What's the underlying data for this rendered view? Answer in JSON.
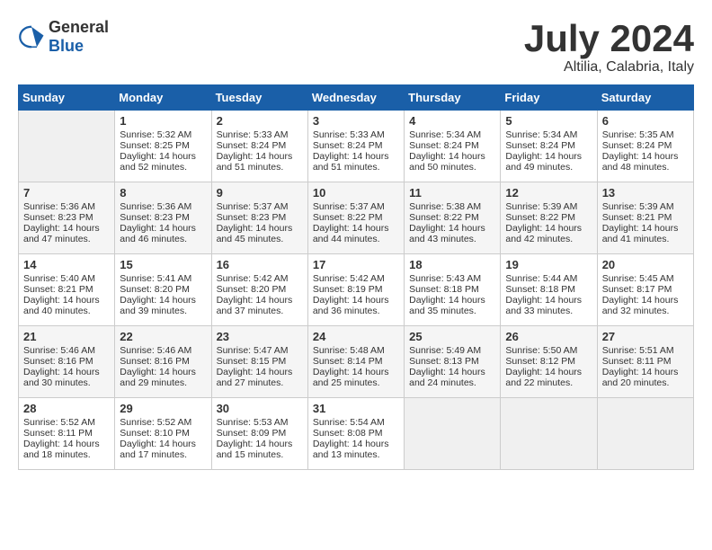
{
  "header": {
    "logo_general": "General",
    "logo_blue": "Blue",
    "month_title": "July 2024",
    "subtitle": "Altilia, Calabria, Italy"
  },
  "weekdays": [
    "Sunday",
    "Monday",
    "Tuesday",
    "Wednesday",
    "Thursday",
    "Friday",
    "Saturday"
  ],
  "weeks": [
    [
      {
        "day": "",
        "sunrise": "",
        "sunset": "",
        "daylight": ""
      },
      {
        "day": "1",
        "sunrise": "Sunrise: 5:32 AM",
        "sunset": "Sunset: 8:25 PM",
        "daylight": "Daylight: 14 hours and 52 minutes."
      },
      {
        "day": "2",
        "sunrise": "Sunrise: 5:33 AM",
        "sunset": "Sunset: 8:24 PM",
        "daylight": "Daylight: 14 hours and 51 minutes."
      },
      {
        "day": "3",
        "sunrise": "Sunrise: 5:33 AM",
        "sunset": "Sunset: 8:24 PM",
        "daylight": "Daylight: 14 hours and 51 minutes."
      },
      {
        "day": "4",
        "sunrise": "Sunrise: 5:34 AM",
        "sunset": "Sunset: 8:24 PM",
        "daylight": "Daylight: 14 hours and 50 minutes."
      },
      {
        "day": "5",
        "sunrise": "Sunrise: 5:34 AM",
        "sunset": "Sunset: 8:24 PM",
        "daylight": "Daylight: 14 hours and 49 minutes."
      },
      {
        "day": "6",
        "sunrise": "Sunrise: 5:35 AM",
        "sunset": "Sunset: 8:24 PM",
        "daylight": "Daylight: 14 hours and 48 minutes."
      }
    ],
    [
      {
        "day": "7",
        "sunrise": "Sunrise: 5:36 AM",
        "sunset": "Sunset: 8:23 PM",
        "daylight": "Daylight: 14 hours and 47 minutes."
      },
      {
        "day": "8",
        "sunrise": "Sunrise: 5:36 AM",
        "sunset": "Sunset: 8:23 PM",
        "daylight": "Daylight: 14 hours and 46 minutes."
      },
      {
        "day": "9",
        "sunrise": "Sunrise: 5:37 AM",
        "sunset": "Sunset: 8:23 PM",
        "daylight": "Daylight: 14 hours and 45 minutes."
      },
      {
        "day": "10",
        "sunrise": "Sunrise: 5:37 AM",
        "sunset": "Sunset: 8:22 PM",
        "daylight": "Daylight: 14 hours and 44 minutes."
      },
      {
        "day": "11",
        "sunrise": "Sunrise: 5:38 AM",
        "sunset": "Sunset: 8:22 PM",
        "daylight": "Daylight: 14 hours and 43 minutes."
      },
      {
        "day": "12",
        "sunrise": "Sunrise: 5:39 AM",
        "sunset": "Sunset: 8:22 PM",
        "daylight": "Daylight: 14 hours and 42 minutes."
      },
      {
        "day": "13",
        "sunrise": "Sunrise: 5:39 AM",
        "sunset": "Sunset: 8:21 PM",
        "daylight": "Daylight: 14 hours and 41 minutes."
      }
    ],
    [
      {
        "day": "14",
        "sunrise": "Sunrise: 5:40 AM",
        "sunset": "Sunset: 8:21 PM",
        "daylight": "Daylight: 14 hours and 40 minutes."
      },
      {
        "day": "15",
        "sunrise": "Sunrise: 5:41 AM",
        "sunset": "Sunset: 8:20 PM",
        "daylight": "Daylight: 14 hours and 39 minutes."
      },
      {
        "day": "16",
        "sunrise": "Sunrise: 5:42 AM",
        "sunset": "Sunset: 8:20 PM",
        "daylight": "Daylight: 14 hours and 37 minutes."
      },
      {
        "day": "17",
        "sunrise": "Sunrise: 5:42 AM",
        "sunset": "Sunset: 8:19 PM",
        "daylight": "Daylight: 14 hours and 36 minutes."
      },
      {
        "day": "18",
        "sunrise": "Sunrise: 5:43 AM",
        "sunset": "Sunset: 8:18 PM",
        "daylight": "Daylight: 14 hours and 35 minutes."
      },
      {
        "day": "19",
        "sunrise": "Sunrise: 5:44 AM",
        "sunset": "Sunset: 8:18 PM",
        "daylight": "Daylight: 14 hours and 33 minutes."
      },
      {
        "day": "20",
        "sunrise": "Sunrise: 5:45 AM",
        "sunset": "Sunset: 8:17 PM",
        "daylight": "Daylight: 14 hours and 32 minutes."
      }
    ],
    [
      {
        "day": "21",
        "sunrise": "Sunrise: 5:46 AM",
        "sunset": "Sunset: 8:16 PM",
        "daylight": "Daylight: 14 hours and 30 minutes."
      },
      {
        "day": "22",
        "sunrise": "Sunrise: 5:46 AM",
        "sunset": "Sunset: 8:16 PM",
        "daylight": "Daylight: 14 hours and 29 minutes."
      },
      {
        "day": "23",
        "sunrise": "Sunrise: 5:47 AM",
        "sunset": "Sunset: 8:15 PM",
        "daylight": "Daylight: 14 hours and 27 minutes."
      },
      {
        "day": "24",
        "sunrise": "Sunrise: 5:48 AM",
        "sunset": "Sunset: 8:14 PM",
        "daylight": "Daylight: 14 hours and 25 minutes."
      },
      {
        "day": "25",
        "sunrise": "Sunrise: 5:49 AM",
        "sunset": "Sunset: 8:13 PM",
        "daylight": "Daylight: 14 hours and 24 minutes."
      },
      {
        "day": "26",
        "sunrise": "Sunrise: 5:50 AM",
        "sunset": "Sunset: 8:12 PM",
        "daylight": "Daylight: 14 hours and 22 minutes."
      },
      {
        "day": "27",
        "sunrise": "Sunrise: 5:51 AM",
        "sunset": "Sunset: 8:11 PM",
        "daylight": "Daylight: 14 hours and 20 minutes."
      }
    ],
    [
      {
        "day": "28",
        "sunrise": "Sunrise: 5:52 AM",
        "sunset": "Sunset: 8:11 PM",
        "daylight": "Daylight: 14 hours and 18 minutes."
      },
      {
        "day": "29",
        "sunrise": "Sunrise: 5:52 AM",
        "sunset": "Sunset: 8:10 PM",
        "daylight": "Daylight: 14 hours and 17 minutes."
      },
      {
        "day": "30",
        "sunrise": "Sunrise: 5:53 AM",
        "sunset": "Sunset: 8:09 PM",
        "daylight": "Daylight: 14 hours and 15 minutes."
      },
      {
        "day": "31",
        "sunrise": "Sunrise: 5:54 AM",
        "sunset": "Sunset: 8:08 PM",
        "daylight": "Daylight: 14 hours and 13 minutes."
      },
      {
        "day": "",
        "sunrise": "",
        "sunset": "",
        "daylight": ""
      },
      {
        "day": "",
        "sunrise": "",
        "sunset": "",
        "daylight": ""
      },
      {
        "day": "",
        "sunrise": "",
        "sunset": "",
        "daylight": ""
      }
    ]
  ]
}
